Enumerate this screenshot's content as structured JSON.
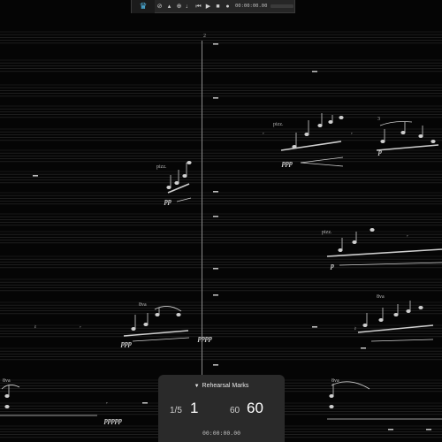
{
  "toolbar": {
    "time": "00:00:00.00",
    "icons": [
      "app-logo-icon",
      "stop-icon",
      "metronome-icon",
      "sync-icon",
      "tempo-icon",
      "rewind-to-start-icon",
      "play-icon",
      "stop-square-icon",
      "record-icon"
    ]
  },
  "score": {
    "bar_number": "2",
    "markings": {
      "pizz_1": "pizz.",
      "pizz_2": "pizz.",
      "pizz_3": "pizz.",
      "ottava_1": "8va",
      "ottava_2": "8va",
      "ottava_3": "8va",
      "ottava_4": "8va",
      "tuplet": "3"
    },
    "dynamics": {
      "d1": "ppp",
      "d2": "pp",
      "d3": "p",
      "d4": "pp",
      "d5": "p",
      "d6": "ppp",
      "d7": "pppp",
      "d8": "ppppp"
    }
  },
  "rehearsal_panel": {
    "title": "Rehearsal Marks",
    "position": "1/5",
    "current_mark": "1",
    "bar_small": "60",
    "bar_big": "60",
    "time": "00:00:00.00"
  },
  "colors": {
    "background": "#050505",
    "staff_line": "#2c2c2c",
    "ink": "#cfcfcf",
    "panel": "#2a2a2a",
    "logo": "#4fb8e6"
  }
}
